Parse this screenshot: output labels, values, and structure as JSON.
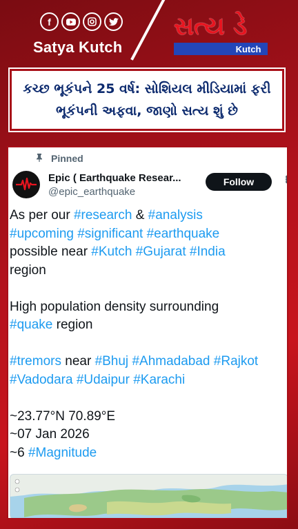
{
  "brand": {
    "left_name": "Satya Kutch",
    "right_name": "સત્ય ડે",
    "right_tag": "Kutch",
    "social_icons": [
      "facebook-icon",
      "youtube-icon",
      "instagram-icon",
      "twitter-icon"
    ]
  },
  "headline": "કચ્છ ભૂકંપને 25 વર્ષ: સોશિયલ મીડિયામાં ફરી ભૂકંપની અફવા, જાણો સત્ય શું છે",
  "tweet": {
    "pinned_label": "Pinned",
    "display_name": "Epic ( Earthquake Resear...",
    "handle": "@epic_earthquake",
    "follow_label": "Follow",
    "lines": [
      [
        {
          "t": "As per our "
        },
        {
          "h": "#research"
        },
        {
          "t": " & "
        },
        {
          "h": "#analysis"
        }
      ],
      [
        {
          "h": "#upcoming"
        },
        {
          "t": " "
        },
        {
          "h": "#significant"
        },
        {
          "t": " "
        },
        {
          "h": "#earthquake"
        }
      ],
      [
        {
          "t": "possible near "
        },
        {
          "h": "#Kutch"
        },
        {
          "t": " "
        },
        {
          "h": "#Gujarat"
        },
        {
          "t": " "
        },
        {
          "h": "#India"
        }
      ],
      [
        {
          "t": "region"
        }
      ],
      [],
      [
        {
          "t": "High population density surrounding"
        }
      ],
      [
        {
          "h": "#quake"
        },
        {
          "t": " region"
        }
      ],
      [],
      [
        {
          "h": "#tremors"
        },
        {
          "t": " near "
        },
        {
          "h": "#Bhuj"
        },
        {
          "t": " "
        },
        {
          "h": "#Ahmadabad"
        },
        {
          "t": " "
        },
        {
          "h": "#Rajkot"
        }
      ],
      [
        {
          "h": "#Vadodara"
        },
        {
          "t": "  "
        },
        {
          "h": "#Udaipur"
        },
        {
          "t": " "
        },
        {
          "h": "#Karachi"
        }
      ],
      [],
      [
        {
          "t": "~23.77°N 70.89°E"
        }
      ],
      [
        {
          "t": "~07 Jan 2026"
        }
      ],
      [
        {
          "t": "~6 "
        },
        {
          "h": "#Magnitude"
        }
      ]
    ]
  },
  "colors": {
    "hashtag": "#1d9bf0",
    "brand_red": "#b3121c",
    "headline_text": "#0c2a6e"
  }
}
